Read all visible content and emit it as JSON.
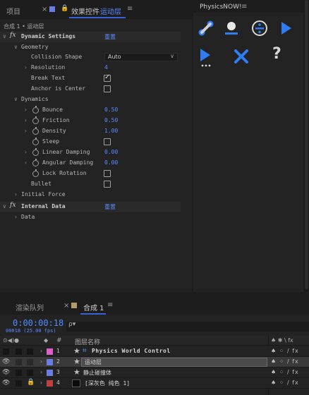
{
  "effect_panel": {
    "tabs": {
      "project": "项目",
      "close": "×",
      "lock": "🔒",
      "effect_controls": "效果控件",
      "layer_name": "运动层",
      "menu": "≡"
    },
    "breadcrumb": "合成 1 • 运动层",
    "rows": {
      "dynamic_settings": {
        "fx": "fx",
        "label": "Dynamic Settings",
        "reset": "重置"
      },
      "geometry": "Geometry",
      "collision_shape": {
        "label": "Collision Shape",
        "value": "Auto"
      },
      "resolution": {
        "label": "Resolution",
        "value": "4"
      },
      "break_text": {
        "label": "Break Text",
        "checked": true
      },
      "anchor_center": {
        "label": "Anchor is Center",
        "checked": false
      },
      "dynamics": "Dynamics",
      "bounce": {
        "label": "Bounce",
        "value": "0.50"
      },
      "friction": {
        "label": "Friction",
        "value": "0.50"
      },
      "density": {
        "label": "Density",
        "value": "1.00"
      },
      "sleep": {
        "label": "Sleep",
        "checked": false
      },
      "linear_damping": {
        "label": "Linear Damping",
        "value": "0.00"
      },
      "angular_damping": {
        "label": "Angular Damping",
        "value": "0.00"
      },
      "lock_rotation": {
        "label": "Lock Rotation",
        "checked": false
      },
      "bullet": {
        "label": "Bullet",
        "checked": false
      },
      "initial_force": "Initial Force",
      "internal_data": {
        "fx": "fx",
        "label": "Internal Data",
        "reset": "重置"
      },
      "data": "Data"
    }
  },
  "physics_panel": {
    "title": "PhysicsNOW!",
    "menu": "≡",
    "buttons": {
      "link": "link-icon",
      "ground": "ground-icon",
      "split": "divide-icon",
      "play": "play-icon",
      "play_more": "play-more-icon",
      "delete": "close-icon",
      "help": "?"
    },
    "accent": "#2f7cf5"
  },
  "timeline": {
    "tabs": {
      "render_queue": "渲染队列",
      "close": "×",
      "comp": "合成 1",
      "menu": "≡"
    },
    "timecode": "0:00:00:18",
    "frame_info": "00018 (25.00 fps)",
    "search_prefix": "ρ▾",
    "header": {
      "icons": "⊙◀)●",
      "label_icon": "◆",
      "num": "#",
      "layer_name": "图层名称",
      "switches": "♠ ✱ \\ fx"
    },
    "layers": [
      {
        "num": "1",
        "name": "Physics World Control",
        "label_color": "#e060c8"
      },
      {
        "num": "2",
        "name": "运动层",
        "label_color": "#6b7de0"
      },
      {
        "num": "3",
        "name": "静止碰撞体",
        "label_color": "#6b7de0"
      },
      {
        "num": "4",
        "name": "[深灰色 纯色 1]",
        "label_color": "#c04040"
      }
    ],
    "switch_glyphs": "♠ ⁘ / fx"
  }
}
